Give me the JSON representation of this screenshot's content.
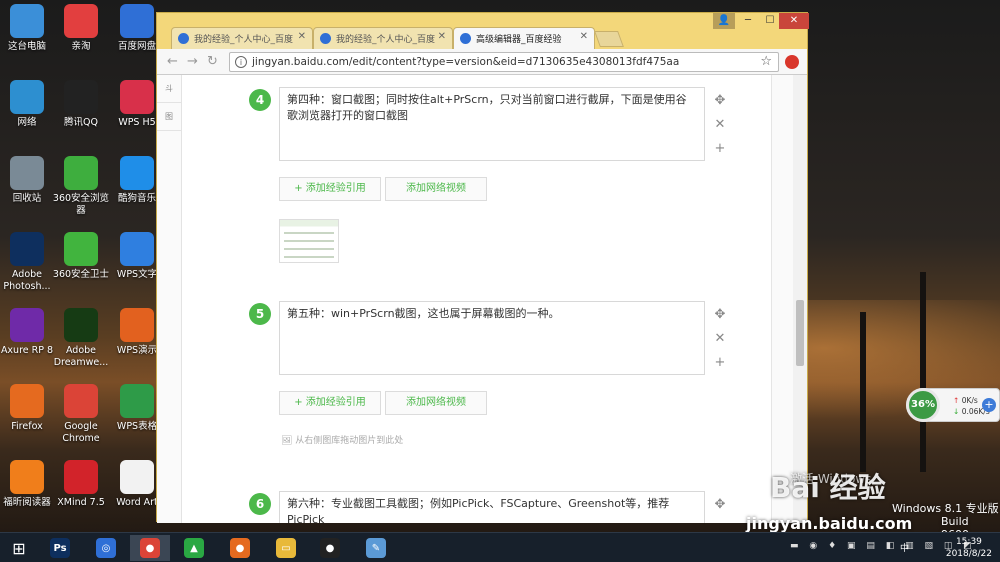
{
  "desktop": {
    "icons": [
      {
        "label": "这台电脑",
        "icon": "computer-icon",
        "color": "#3b8fd8"
      },
      {
        "label": "亲淘",
        "icon": "qintao-icon",
        "color": "#e23f3f"
      },
      {
        "label": "百度网盘",
        "icon": "baidu-netdisk-icon",
        "color": "#2f6fd6"
      },
      {
        "label": "网络",
        "icon": "network-icon",
        "color": "#2d8fd0"
      },
      {
        "label": "腾讯QQ",
        "icon": "qq-icon",
        "color": "#222222"
      },
      {
        "label": "WPS H5",
        "icon": "wps-h5-icon",
        "color": "#d8304a"
      },
      {
        "label": "回收站",
        "icon": "recycle-bin-icon",
        "color": "#7a8a96"
      },
      {
        "label": "360安全浏览器",
        "icon": "360-browser-icon",
        "color": "#3eae3e"
      },
      {
        "label": "酷狗音乐",
        "icon": "kugou-icon",
        "color": "#1f8ee8"
      },
      {
        "label": "Adobe Photosh...",
        "icon": "photoshop-icon",
        "color": "#0e2f5e"
      },
      {
        "label": "360安全卫士",
        "icon": "360-guard-icon",
        "color": "#41b43e"
      },
      {
        "label": "WPS文字",
        "icon": "wps-writer-icon",
        "color": "#2f7fe0"
      },
      {
        "label": "Axure RP 8",
        "icon": "axure-icon",
        "color": "#6f2aa8"
      },
      {
        "label": "Adobe Dreamwe...",
        "icon": "dreamweaver-icon",
        "color": "#163b14"
      },
      {
        "label": "WPS演示",
        "icon": "wps-presentation-icon",
        "color": "#e2611f"
      },
      {
        "label": "Firefox",
        "icon": "firefox-icon",
        "color": "#e56a1f"
      },
      {
        "label": "Google Chrome",
        "icon": "chrome-icon",
        "color": "#db4437"
      },
      {
        "label": "WPS表格",
        "icon": "wps-spreadsheet-icon",
        "color": "#2e9b48"
      },
      {
        "label": "福昕阅读器",
        "icon": "foxit-reader-icon",
        "color": "#f07e1b"
      },
      {
        "label": "XMind 7.5",
        "icon": "xmind-icon",
        "color": "#d2232a"
      },
      {
        "label": "Word Art",
        "icon": "word-art-icon",
        "color": "#f2f2f2"
      }
    ]
  },
  "browser": {
    "tabs": [
      {
        "label": "我的经验_个人中心_百度",
        "active": false
      },
      {
        "label": "我的经验_个人中心_百度",
        "active": false
      },
      {
        "label": "高级编辑器_百度经验",
        "active": true
      }
    ],
    "url": "jingyan.baidu.com/edit/content?type=version&eid=d7130635e4308013fdf475aa",
    "sidebar_tabs": [
      "斗",
      "图"
    ],
    "steps": [
      {
        "num": "4",
        "text": "第四种：窗口截图；同时按住alt+PrScrn，只对当前窗口进行截屏，下面是使用谷歌浏览器打开的窗口截图"
      },
      {
        "num": "5",
        "text": "第五种：win+PrScrn截图，这也属于屏幕截图的一种。"
      },
      {
        "num": "6",
        "text": "第六种：专业截图工具截图；例如PicPick、FSCapture、Greenshot等，推荐PicPick"
      }
    ],
    "add_ref_label": "+ 添加经验引用",
    "add_video_label": "添加网络视频",
    "drop_hint": "从右侧图库拖动图片到此处"
  },
  "network_widget": {
    "percent": "36%",
    "upload": "0K/s",
    "download": "0.06K/s"
  },
  "watermark": {
    "brand": "Bai 经验",
    "url": "jingyan.baidu.com",
    "windows": "Windows 8.1 专业版",
    "build": "Build 9600",
    "activate": "激活 Windows"
  },
  "taskbar": {
    "apps": [
      {
        "name": "photoshop-icon",
        "label": "Ps",
        "color": "#0e2f5e"
      },
      {
        "name": "baidu-netdisk-icon",
        "label": "◎",
        "color": "#2f6fd6"
      },
      {
        "name": "chrome-icon",
        "label": "●",
        "color": "#db4437"
      },
      {
        "name": "green-app-icon",
        "label": "▲",
        "color": "#2aa843"
      },
      {
        "name": "firefox-icon",
        "label": "●",
        "color": "#e56a1f"
      },
      {
        "name": "file-explorer-icon",
        "label": "▭",
        "color": "#e8b93a"
      },
      {
        "name": "qq-icon",
        "label": "●",
        "color": "#222"
      },
      {
        "name": "paint-icon",
        "label": "✎",
        "color": "#5b9ad6"
      }
    ],
    "ime": "中",
    "time": "15:39",
    "date": "2018/8/22"
  }
}
